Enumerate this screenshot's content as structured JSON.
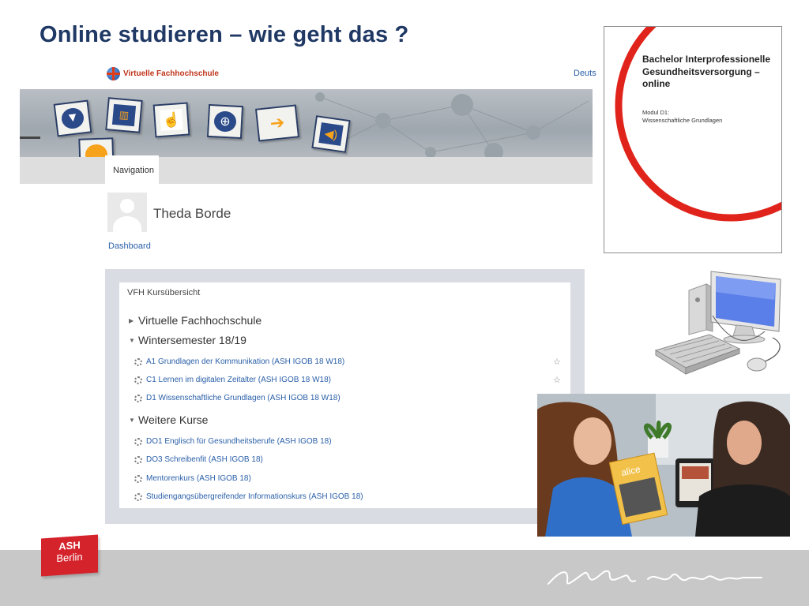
{
  "slide": {
    "title": "Online studieren – wie geht das ?"
  },
  "screenshot": {
    "logo_text": "Virtuelle Fachhochschule",
    "language": "Deuts",
    "nav_tab": "Navigation",
    "user_name": "Theda Borde",
    "dashboard_link": "Dashboard",
    "panel_title": "VFH Kursübersicht",
    "categories": [
      {
        "label": "Virtuelle Fachhochschule",
        "expanded": false
      },
      {
        "label": "Wintersemester 18/19",
        "expanded": true
      },
      {
        "label": "Weitere Kurse",
        "expanded": true
      }
    ],
    "winter_courses": [
      "A1 Grundlagen der Kommunikation (ASH IGOB 18 W18)",
      "C1 Lernen im digitalen Zeitalter (ASH IGOB 18 W18)",
      "D1 Wissenschaftliche Grundlagen (ASH IGOB 18 W18)"
    ],
    "further_courses": [
      "DO1 Englisch für Gesundheitsberufe (ASH IGOB 18)",
      "DO3 Schreibenfit (ASH IGOB 18)",
      "Mentorenkurs (ASH IGOB 18)",
      "Studiengangsübergreifender Informationskurs (ASH IGOB 18)"
    ],
    "star_glyph": "☆"
  },
  "cover": {
    "title": "Bachelor Interprofessionelle Gesundheitsversorgung – online",
    "subtitle_line1": "Modul D1:",
    "subtitle_line2": "Wissenschaftliche Grundlagen"
  },
  "photo": {
    "magazine_text": "alice"
  },
  "footer": {
    "logo_line1": "ASH",
    "logo_line2": "Berlin"
  },
  "colors": {
    "title": "#1f3864",
    "link": "#2a5fa8",
    "accent_red": "#d5232c",
    "footer_bg": "#c8c8c8",
    "panel_bg": "#d9dde3"
  }
}
